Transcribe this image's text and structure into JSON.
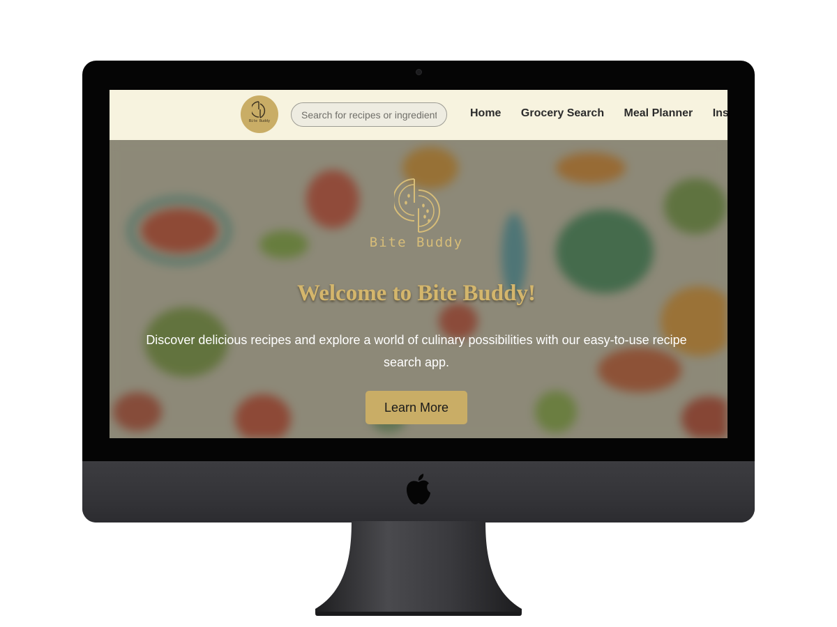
{
  "navbar": {
    "logo_text": "Bite Buddy",
    "search": {
      "placeholder": "Search for recipes or ingredients",
      "value": ""
    },
    "links": [
      {
        "label": "Home"
      },
      {
        "label": "Grocery Search"
      },
      {
        "label": "Meal Planner"
      },
      {
        "label": "Ins"
      }
    ]
  },
  "hero": {
    "brand": "Bite Buddy",
    "title": "Welcome to Bite Buddy!",
    "text": "Discover delicious recipes and explore a world of culinary possibilities with our easy-to-use recipe search app.",
    "button_label": "Learn More"
  },
  "icons": {
    "logo": "watermelon-slice-icon",
    "device_logo": "apple-icon"
  },
  "colors": {
    "accent_gold": "#c9ad66",
    "navbar_bg": "#f7f3df",
    "device_frame": "#050505",
    "device_chin": "#36363a"
  }
}
